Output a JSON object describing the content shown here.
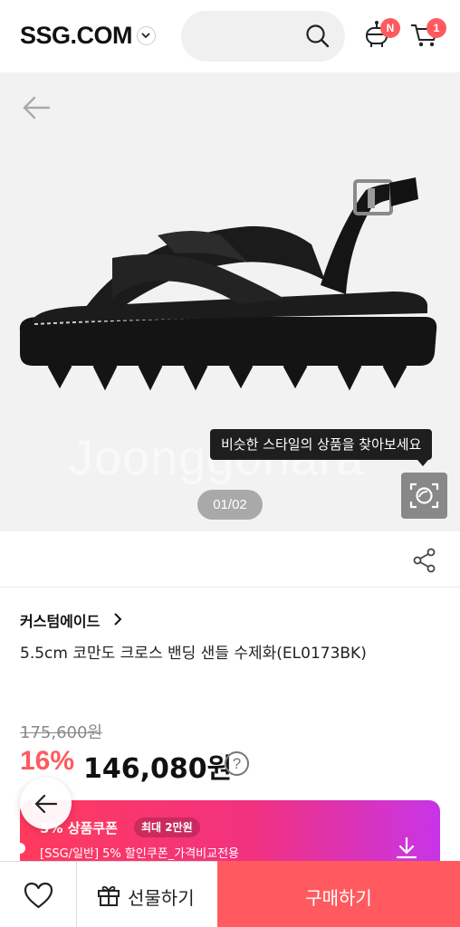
{
  "header": {
    "logo": "SSG.COM",
    "notification_badge": "N",
    "cart_badge": "1"
  },
  "gallery": {
    "watermark": "Joonggonara",
    "similar_style_tooltip": "비슷한 스타일의 상품을 찾아보세요",
    "pager": "01/02"
  },
  "product": {
    "brand": "커스텀에이드",
    "title": "5.5cm 코만도 크로스 밴딩 샌들 수제화(EL0173BK)",
    "original_price": "175,600원",
    "discount_rate": "16%",
    "sale_price": "146,080원",
    "help": "?"
  },
  "coupon": {
    "title": "5% 상품쿠폰",
    "max_label": "최대 2만원",
    "description": "[SSG/일반] 5% 할인쿠폰_가격비교전용"
  },
  "bottom_bar": {
    "gift_label": "선물하기",
    "buy_label": "구매하기"
  },
  "colors": {
    "accent": "#ff5a5f",
    "coupon_gradient_start": "#ff3a5c",
    "coupon_gradient_end": "#c734e8"
  }
}
